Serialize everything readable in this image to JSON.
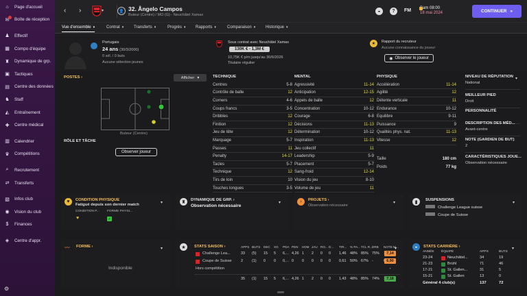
{
  "sidebar": {
    "items": [
      {
        "label": "Page d'accueil",
        "icon": "home-icon",
        "glyph": "⌂"
      },
      {
        "label": "Boîte de réception",
        "icon": "inbox-icon",
        "glyph": "✉",
        "badge": true
      },
      {
        "label": "Effectif",
        "icon": "squad-icon",
        "glyph": "♟"
      },
      {
        "label": "Compo d'équipe",
        "icon": "tactics-board-icon",
        "glyph": "▦"
      },
      {
        "label": "Dynamique de grp.",
        "icon": "dynamics-icon",
        "glyph": "♜"
      },
      {
        "label": "Tactiques",
        "icon": "tactics-icon",
        "glyph": "▣"
      },
      {
        "label": "Centre des données",
        "icon": "data-icon",
        "glyph": "▤"
      },
      {
        "label": "Staff",
        "icon": "staff-icon",
        "glyph": "♞"
      },
      {
        "label": "Entraînement",
        "icon": "training-icon",
        "glyph": "◭"
      },
      {
        "label": "Centre médical",
        "icon": "medical-icon",
        "glyph": "✚"
      },
      {
        "label": "Calendrier",
        "icon": "calendar-icon",
        "glyph": "▥"
      },
      {
        "label": "Compétitions",
        "icon": "trophy-icon",
        "glyph": "♛"
      },
      {
        "label": "Recrutement",
        "icon": "scouting-icon",
        "glyph": "⌕"
      },
      {
        "label": "Transferts",
        "icon": "transfers-icon",
        "glyph": "⇄"
      },
      {
        "label": "Infos club",
        "icon": "club-info-icon",
        "glyph": "▧"
      },
      {
        "label": "Vision du club",
        "icon": "vision-icon",
        "glyph": "◉"
      },
      {
        "label": "Finances",
        "icon": "finances-icon",
        "glyph": "$"
      },
      {
        "label": "Centre d'appr.",
        "icon": "learning-icon",
        "glyph": "◈"
      }
    ],
    "gear_glyph": "⚙"
  },
  "topbar": {
    "back": "‹",
    "forward": "›",
    "player_icon": "👤",
    "title": "32. Ângelo Campos",
    "subtitle": "Buteur (Centre) / MO (G) - Neuchâtel Xamax",
    "date_day": "Sam 08:00",
    "date": "18 mai 2024",
    "continue": "CONTINUER",
    "continue_icon": "»",
    "fm": "FM",
    "help": "?",
    "world_icon": "◒",
    "club_color": "#e01f26"
  },
  "tabs": [
    "Vue d'ensemble",
    "Contrat",
    "Transferts",
    "Progrès",
    "Rapports",
    "Comparaison",
    "Historique"
  ],
  "profile": {
    "nation": "Portugais",
    "age": "24 ans",
    "dob": "(30/3/2000)",
    "caps": "0 sél. / 0 buts",
    "intl": "Aucune sélection jeunes",
    "contract_label": "Sous contrat avec Neuchâtel Xamax",
    "value": "130K € - 1,3M €",
    "contract_until": "10,75K € p/m jusqu'au 30/6/2026",
    "status": "Titulaire régulier",
    "report_title": "Rapport du recruteur",
    "report_sub": "Aucune connaissance du joueur",
    "report_btn": "Observer le joueur"
  },
  "positions": {
    "title": "POSTES ›",
    "show": "Afficher",
    "position_label": "Buteur (Centre)",
    "role_title": "RÔLE ET TÂCHE",
    "observe_btn": "Observer joueur"
  },
  "technique": {
    "title": "TECHNIQUE",
    "rows": [
      [
        "Centres",
        "5-8",
        "w"
      ],
      [
        "Contrôle de balle",
        "12",
        "y"
      ],
      [
        "Corners",
        "4-6",
        "w"
      ],
      [
        "Coups francs",
        "3-5",
        "w"
      ],
      [
        "Dribbles",
        "12",
        "y"
      ],
      [
        "Finition",
        "12",
        "y"
      ],
      [
        "Jeu de tête",
        "12",
        "y"
      ],
      [
        "Marquage",
        "5-7",
        "w"
      ],
      [
        "Passes",
        "11",
        "y"
      ],
      [
        "Penalty",
        "14-17",
        "y"
      ],
      [
        "Tacles",
        "5-7",
        "w"
      ],
      [
        "Technique",
        "12",
        "y"
      ],
      [
        "Tirs de loin",
        "10",
        "w"
      ],
      [
        "Touches longues",
        "3-5",
        "w"
      ]
    ]
  },
  "mental": {
    "title": "MENTAL",
    "rows": [
      [
        "Agressivité",
        "11-14",
        "y"
      ],
      [
        "Anticipation",
        "12-15",
        "y"
      ],
      [
        "Appels de balle",
        "12",
        "y"
      ],
      [
        "Concentration",
        "10-12",
        "w"
      ],
      [
        "Courage",
        "6-8",
        "w"
      ],
      [
        "Décisions",
        "11-13",
        "y"
      ],
      [
        "Détermination",
        "10-12",
        "w"
      ],
      [
        "Inspiration",
        "11-13",
        "y"
      ],
      [
        "Jeu collectif",
        "11",
        "y"
      ],
      [
        "Leadership",
        "5-9",
        "w"
      ],
      [
        "Placement",
        "5-7",
        "w"
      ],
      [
        "Sang-froid",
        "12-14",
        "y"
      ],
      [
        "Vision du jeu",
        "8-10",
        "w"
      ],
      [
        "Volume de jeu",
        "11",
        "y"
      ]
    ]
  },
  "physique": {
    "title": "PHYSIQUE",
    "rows": [
      [
        "Accélération",
        "11-14",
        "y"
      ],
      [
        "Agilité",
        "12",
        "y"
      ],
      [
        "Détente verticale",
        "11",
        "y"
      ],
      [
        "Endurance",
        "10-12",
        "w"
      ],
      [
        "Equilibre",
        "9-11",
        "w"
      ],
      [
        "Puissance",
        "9",
        "w"
      ],
      [
        "Qualités phys. nat.",
        "11-13",
        "y"
      ],
      [
        "Vitesse",
        "12",
        "y"
      ]
    ],
    "extra": [
      [
        "Taille",
        "180 cm"
      ],
      [
        "Poids",
        "77 kg"
      ]
    ]
  },
  "right": [
    [
      "NIVEAU DE RÉPUTATION",
      "National"
    ],
    [
      "MEILLEUR PIED",
      "Droit"
    ],
    [
      "PERSONNALITÉ",
      ""
    ],
    [
      "DESCRIPTION DES MÉD...",
      "Avant-centre"
    ],
    [
      "NOTE (GARDIEN DE BUT)",
      "2"
    ],
    [
      "CARACTÉRISTIQUES JOUE...",
      "Observation nécessaire"
    ]
  ],
  "mid": {
    "cond_title": "CONDITION PHYSIQUE",
    "cond_text": "Fatigué depuis son dernier match",
    "cond_l1": "CONDITION P...",
    "cond_l2": "FORME PHYSI...",
    "dyn_title": "DYNAMIQUE DE GRP. ›",
    "dyn_text": "Observation nécessaire",
    "proj_title": "PROJETS ›",
    "proj_text": "Observation nécessaire",
    "susp_title": "SUSPENSIONS",
    "susp_rows": [
      "Challenge League suisse",
      "Coupe de Suisse"
    ]
  },
  "form": {
    "title": "FORME ›",
    "text": "Indisponible"
  },
  "season": {
    "title": "STATS SAISON ›",
    "cols": [
      "APPS",
      "BUTS",
      "DEC",
      "XG",
      "PDA",
      "PEN",
      "HDM",
      "JAU",
      "RO...",
      "D...",
      "TIR...",
      "% PA...",
      "TCL R...",
      "DRB",
      "NOTE M..."
    ],
    "rows": [
      {
        "name": "Challenge Lea...",
        "vals": [
          "33",
          "(5)",
          "15",
          "5",
          "6,...",
          "4,26",
          "1",
          "2",
          "0",
          "0",
          "1,46",
          "48%",
          "85%",
          "75%",
          "13"
        ],
        "rating": "7,14",
        "rc": "#f08f3b"
      },
      {
        "name": "Coupe de Suisse",
        "vals": [
          "2",
          "(1)",
          "0",
          "0",
          "0,...",
          "0",
          "0",
          "0",
          "0",
          "0",
          "0,61",
          "50%",
          "67%",
          "-",
          "0"
        ],
        "rating": "6,90",
        "rc": "#f08f3b"
      },
      {
        "name": "Hors compétition",
        "vals": [
          "",
          "",
          "",
          "",
          "",
          "",
          "",
          "",
          "",
          "",
          "",
          "",
          "",
          "",
          ""
        ],
        "rating": "-",
        "rc": ""
      },
      {
        "name": "",
        "vals": [
          "35",
          "(1)",
          "15",
          "5",
          "6,...",
          "4,26",
          "1",
          "2",
          "0",
          "0",
          "1,43",
          "48%",
          "85%",
          "74%",
          "13"
        ],
        "rating": "7,18",
        "rc": "#4aa84a"
      }
    ]
  },
  "career": {
    "title": "STATS CARRIÈRE ›",
    "cols": [
      "ANNÉE",
      "ÉQUIPE",
      "APPS",
      "BUTS"
    ],
    "rows": [
      [
        "23-24",
        "Neuchâtel...",
        "34",
        "19"
      ],
      [
        "21-23",
        "Brühl",
        "71",
        "46"
      ],
      [
        "17-21",
        "St. Gallen...",
        "31",
        "5"
      ],
      [
        "15-21",
        "St. Gallen",
        "13",
        "0"
      ]
    ],
    "total": [
      "Général 4 club(s)",
      "137",
      "72"
    ]
  }
}
